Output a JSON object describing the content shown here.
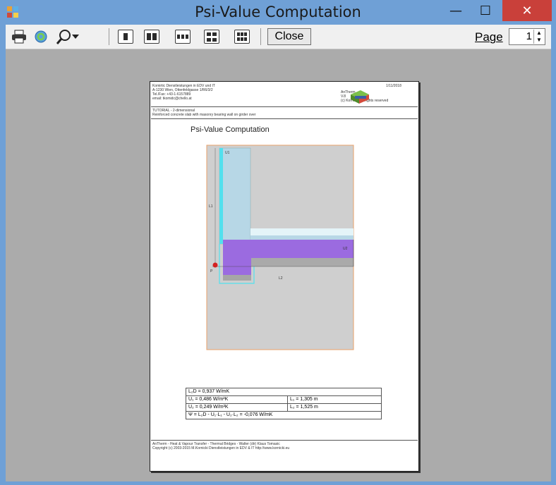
{
  "window": {
    "title": "Psi-Value Computation",
    "minimize_glyph": "—",
    "maximize_glyph": "☐",
    "close_glyph": "✕",
    "accent_color": "#6fa0d6",
    "close_color": "#c9403a"
  },
  "toolbar": {
    "print_icon": "printer-icon",
    "refresh_icon": "refresh-icon",
    "zoom_icon": "magnifier-icon",
    "page_layout_icons": [
      "one-page-icon",
      "two-pages-icon",
      "three-pages-icon",
      "four-pages-icon",
      "six-pages-icon"
    ],
    "close_label": "Close",
    "page_label": "Page",
    "page_value": "1"
  },
  "document": {
    "header_left_lines": [
      "Komirtic Dienstleistungen in EDV und IT",
      "A-1230 Wien, Ottenfeldgasse 1/R6/3/2",
      "Tel./Fax: +43-1-6157889",
      "email: tkomidc@chello.at"
    ],
    "header_date": "1/11/2018",
    "header_right_lines": [
      "AnTherm",
      "V.8",
      "(c) Kornicki, all rights reserved"
    ],
    "tutorial_lines": [
      "TUTORIAL - 2-dimensional",
      "Reinforced concrete slab with masonry bearing wall on girder over"
    ],
    "heading": "Psi-Value Computation",
    "labels": {
      "u1": "U1",
      "l1": "L1",
      "u2": "U2",
      "l2": "L2",
      "p": "P"
    },
    "results": {
      "l2d": "L₂D = 0,937 W/mK",
      "u1": "U₁ = 0,486 W/m²K",
      "l1": "L₁ = 1,305 m",
      "u2": "U₂ = 0,249 W/m²K",
      "l2": "L₂ = 1,525 m",
      "psi": "Ψ = L₂D - U₁·L₁ - U₂·L₂ = -0,076 W/mK"
    },
    "footer_lines": [
      "AnTherm - Heat & Vapour Transfer - Thermal Bridges - Walter (dir) Klaus Tomasic",
      "Copyright (c) 2003-2015 M.Kornicki Dienstleistungen in EDV & IT  http://www.kornicki.eu"
    ]
  }
}
